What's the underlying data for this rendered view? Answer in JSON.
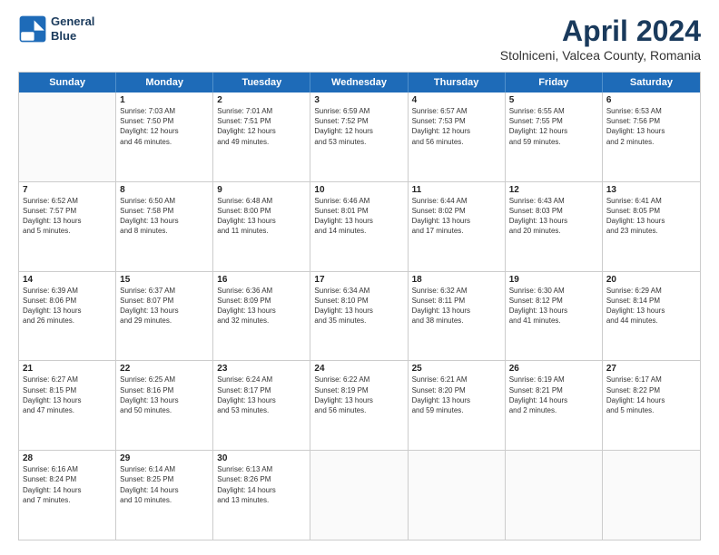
{
  "header": {
    "logo_line1": "General",
    "logo_line2": "Blue",
    "title": "April 2024",
    "subtitle": "Stolniceni, Valcea County, Romania"
  },
  "day_names": [
    "Sunday",
    "Monday",
    "Tuesday",
    "Wednesday",
    "Thursday",
    "Friday",
    "Saturday"
  ],
  "weeks": [
    [
      {
        "day": "",
        "lines": []
      },
      {
        "day": "1",
        "lines": [
          "Sunrise: 7:03 AM",
          "Sunset: 7:50 PM",
          "Daylight: 12 hours",
          "and 46 minutes."
        ]
      },
      {
        "day": "2",
        "lines": [
          "Sunrise: 7:01 AM",
          "Sunset: 7:51 PM",
          "Daylight: 12 hours",
          "and 49 minutes."
        ]
      },
      {
        "day": "3",
        "lines": [
          "Sunrise: 6:59 AM",
          "Sunset: 7:52 PM",
          "Daylight: 12 hours",
          "and 53 minutes."
        ]
      },
      {
        "day": "4",
        "lines": [
          "Sunrise: 6:57 AM",
          "Sunset: 7:53 PM",
          "Daylight: 12 hours",
          "and 56 minutes."
        ]
      },
      {
        "day": "5",
        "lines": [
          "Sunrise: 6:55 AM",
          "Sunset: 7:55 PM",
          "Daylight: 12 hours",
          "and 59 minutes."
        ]
      },
      {
        "day": "6",
        "lines": [
          "Sunrise: 6:53 AM",
          "Sunset: 7:56 PM",
          "Daylight: 13 hours",
          "and 2 minutes."
        ]
      }
    ],
    [
      {
        "day": "7",
        "lines": [
          "Sunrise: 6:52 AM",
          "Sunset: 7:57 PM",
          "Daylight: 13 hours",
          "and 5 minutes."
        ]
      },
      {
        "day": "8",
        "lines": [
          "Sunrise: 6:50 AM",
          "Sunset: 7:58 PM",
          "Daylight: 13 hours",
          "and 8 minutes."
        ]
      },
      {
        "day": "9",
        "lines": [
          "Sunrise: 6:48 AM",
          "Sunset: 8:00 PM",
          "Daylight: 13 hours",
          "and 11 minutes."
        ]
      },
      {
        "day": "10",
        "lines": [
          "Sunrise: 6:46 AM",
          "Sunset: 8:01 PM",
          "Daylight: 13 hours",
          "and 14 minutes."
        ]
      },
      {
        "day": "11",
        "lines": [
          "Sunrise: 6:44 AM",
          "Sunset: 8:02 PM",
          "Daylight: 13 hours",
          "and 17 minutes."
        ]
      },
      {
        "day": "12",
        "lines": [
          "Sunrise: 6:43 AM",
          "Sunset: 8:03 PM",
          "Daylight: 13 hours",
          "and 20 minutes."
        ]
      },
      {
        "day": "13",
        "lines": [
          "Sunrise: 6:41 AM",
          "Sunset: 8:05 PM",
          "Daylight: 13 hours",
          "and 23 minutes."
        ]
      }
    ],
    [
      {
        "day": "14",
        "lines": [
          "Sunrise: 6:39 AM",
          "Sunset: 8:06 PM",
          "Daylight: 13 hours",
          "and 26 minutes."
        ]
      },
      {
        "day": "15",
        "lines": [
          "Sunrise: 6:37 AM",
          "Sunset: 8:07 PM",
          "Daylight: 13 hours",
          "and 29 minutes."
        ]
      },
      {
        "day": "16",
        "lines": [
          "Sunrise: 6:36 AM",
          "Sunset: 8:09 PM",
          "Daylight: 13 hours",
          "and 32 minutes."
        ]
      },
      {
        "day": "17",
        "lines": [
          "Sunrise: 6:34 AM",
          "Sunset: 8:10 PM",
          "Daylight: 13 hours",
          "and 35 minutes."
        ]
      },
      {
        "day": "18",
        "lines": [
          "Sunrise: 6:32 AM",
          "Sunset: 8:11 PM",
          "Daylight: 13 hours",
          "and 38 minutes."
        ]
      },
      {
        "day": "19",
        "lines": [
          "Sunrise: 6:30 AM",
          "Sunset: 8:12 PM",
          "Daylight: 13 hours",
          "and 41 minutes."
        ]
      },
      {
        "day": "20",
        "lines": [
          "Sunrise: 6:29 AM",
          "Sunset: 8:14 PM",
          "Daylight: 13 hours",
          "and 44 minutes."
        ]
      }
    ],
    [
      {
        "day": "21",
        "lines": [
          "Sunrise: 6:27 AM",
          "Sunset: 8:15 PM",
          "Daylight: 13 hours",
          "and 47 minutes."
        ]
      },
      {
        "day": "22",
        "lines": [
          "Sunrise: 6:25 AM",
          "Sunset: 8:16 PM",
          "Daylight: 13 hours",
          "and 50 minutes."
        ]
      },
      {
        "day": "23",
        "lines": [
          "Sunrise: 6:24 AM",
          "Sunset: 8:17 PM",
          "Daylight: 13 hours",
          "and 53 minutes."
        ]
      },
      {
        "day": "24",
        "lines": [
          "Sunrise: 6:22 AM",
          "Sunset: 8:19 PM",
          "Daylight: 13 hours",
          "and 56 minutes."
        ]
      },
      {
        "day": "25",
        "lines": [
          "Sunrise: 6:21 AM",
          "Sunset: 8:20 PM",
          "Daylight: 13 hours",
          "and 59 minutes."
        ]
      },
      {
        "day": "26",
        "lines": [
          "Sunrise: 6:19 AM",
          "Sunset: 8:21 PM",
          "Daylight: 14 hours",
          "and 2 minutes."
        ]
      },
      {
        "day": "27",
        "lines": [
          "Sunrise: 6:17 AM",
          "Sunset: 8:22 PM",
          "Daylight: 14 hours",
          "and 5 minutes."
        ]
      }
    ],
    [
      {
        "day": "28",
        "lines": [
          "Sunrise: 6:16 AM",
          "Sunset: 8:24 PM",
          "Daylight: 14 hours",
          "and 7 minutes."
        ]
      },
      {
        "day": "29",
        "lines": [
          "Sunrise: 6:14 AM",
          "Sunset: 8:25 PM",
          "Daylight: 14 hours",
          "and 10 minutes."
        ]
      },
      {
        "day": "30",
        "lines": [
          "Sunrise: 6:13 AM",
          "Sunset: 8:26 PM",
          "Daylight: 14 hours",
          "and 13 minutes."
        ]
      },
      {
        "day": "",
        "lines": []
      },
      {
        "day": "",
        "lines": []
      },
      {
        "day": "",
        "lines": []
      },
      {
        "day": "",
        "lines": []
      }
    ]
  ]
}
